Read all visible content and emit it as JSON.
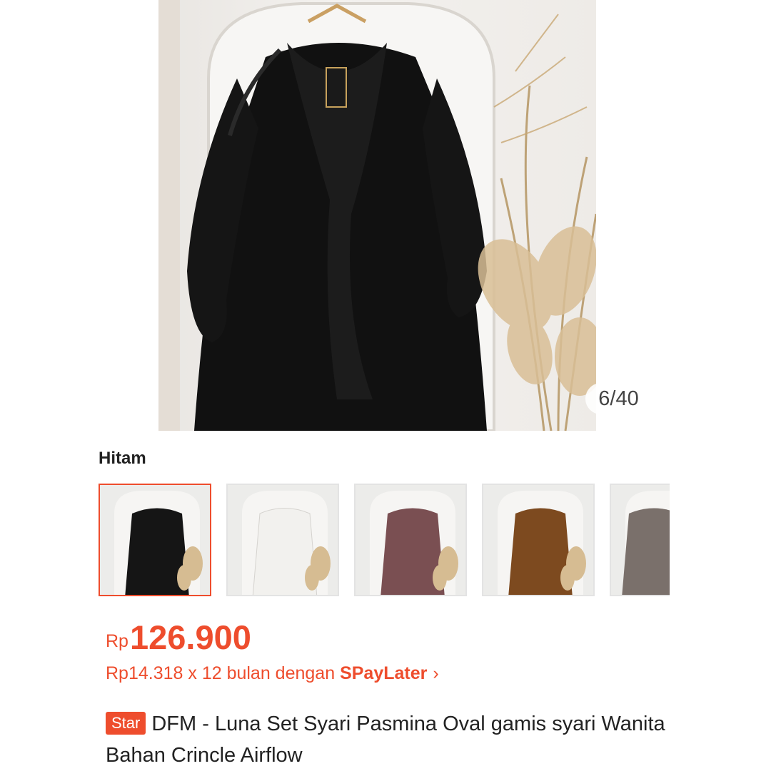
{
  "gallery": {
    "counter": "6/40",
    "product_color": "#111111"
  },
  "variant": {
    "label": "Hitam",
    "options": [
      {
        "color": "#151515",
        "selected": true
      },
      {
        "color": "#f2f1ee",
        "selected": false
      },
      {
        "color": "#7a4f52",
        "selected": false
      },
      {
        "color": "#7d4a1f",
        "selected": false
      },
      {
        "color": "#7a706b",
        "selected": false
      }
    ]
  },
  "price": {
    "currency": "Rp",
    "amount": "126.900"
  },
  "installment": {
    "text": "Rp14.318 x 12 bulan dengan ",
    "brand": "SPayLater",
    "chevron": "›"
  },
  "product": {
    "badge": "Star",
    "title": "DFM - Luna Set Syari Pasmina Oval gamis syari Wanita Bahan Crincle Airflow"
  },
  "colors": {
    "accent": "#ee4d2d"
  }
}
